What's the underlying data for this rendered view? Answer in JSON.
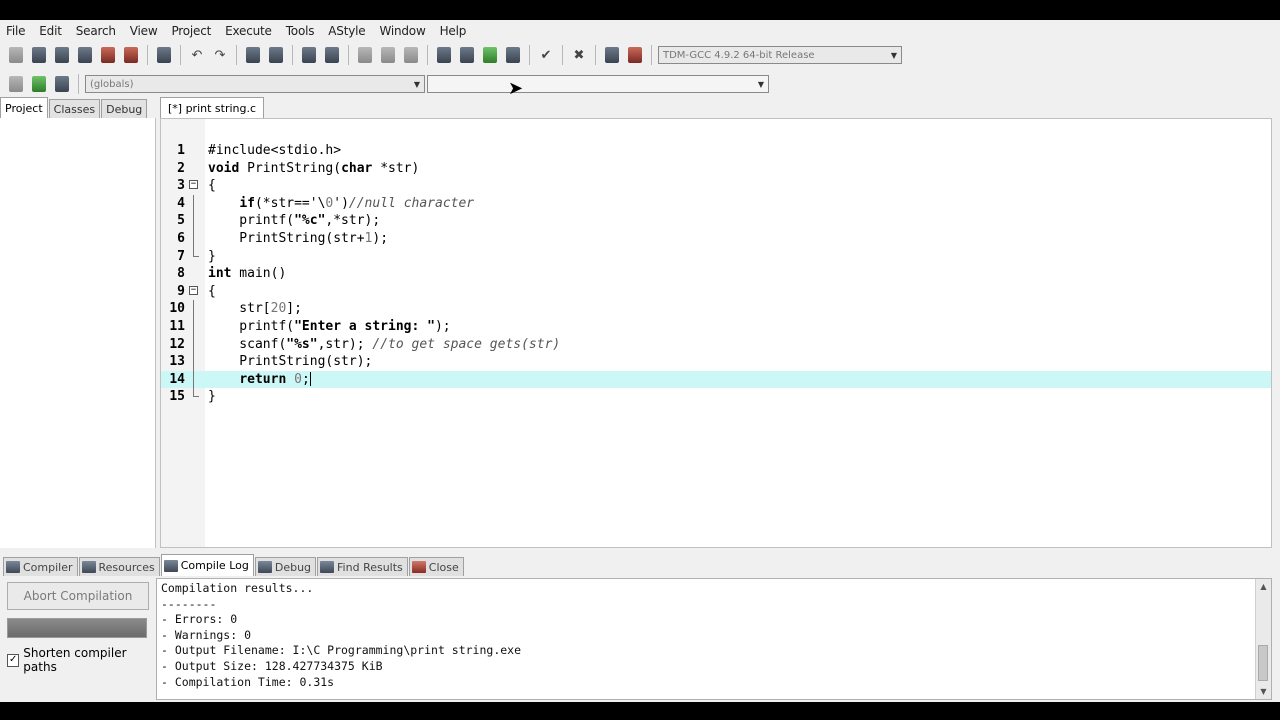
{
  "menu": [
    "File",
    "Edit",
    "Search",
    "View",
    "Project",
    "Execute",
    "Tools",
    "AStyle",
    "Window",
    "Help"
  ],
  "toolbar": {
    "compiler_select": "TDM-GCC 4.9.2 64-bit Release",
    "scope_select": "(globals)",
    "function_select": ""
  },
  "left_tabs": [
    "Project",
    "Classes",
    "Debug"
  ],
  "editor": {
    "tab_label": "[*] print string.c",
    "current_line": 14,
    "lines": [
      {
        "n": "1",
        "text": "#include<stdio.h>"
      },
      {
        "n": "2",
        "text": "void PrintString(char *str)"
      },
      {
        "n": "3",
        "text": "{"
      },
      {
        "n": "4",
        "text": "    if(*str=='\\0')//null character"
      },
      {
        "n": "5",
        "text": "    printf(\"%c\",*str);"
      },
      {
        "n": "6",
        "text": "    PrintString(str+1);"
      },
      {
        "n": "7",
        "text": "}"
      },
      {
        "n": "8",
        "text": "int main()"
      },
      {
        "n": "9",
        "text": "{"
      },
      {
        "n": "10",
        "text": "    str[20];"
      },
      {
        "n": "11",
        "text": "    printf(\"Enter a string: \");"
      },
      {
        "n": "12",
        "text": "    scanf(\"%s\",str); //to get space gets(str)"
      },
      {
        "n": "13",
        "text": "    PrintString(str);"
      },
      {
        "n": "14",
        "text": "    return 0;"
      },
      {
        "n": "15",
        "text": "}"
      }
    ]
  },
  "bottom_tabs": [
    "Compiler",
    "Resources",
    "Compile Log",
    "Debug",
    "Find Results",
    "Close"
  ],
  "bottom_active_tab": "Compile Log",
  "compile": {
    "abort_label": "Abort Compilation",
    "shorten_label": "Shorten compiler paths",
    "shorten_checked": true,
    "log": [
      "Compilation results...",
      "--------",
      "- Errors: 0",
      "- Warnings: 0",
      "- Output Filename: I:\\C Programming\\print string.exe",
      "- Output Size: 128.427734375 KiB",
      "- Compilation Time: 0.31s"
    ]
  },
  "colors": {
    "current_line_bg": "#ccf7f7",
    "window_bg": "#f0f0f0"
  }
}
